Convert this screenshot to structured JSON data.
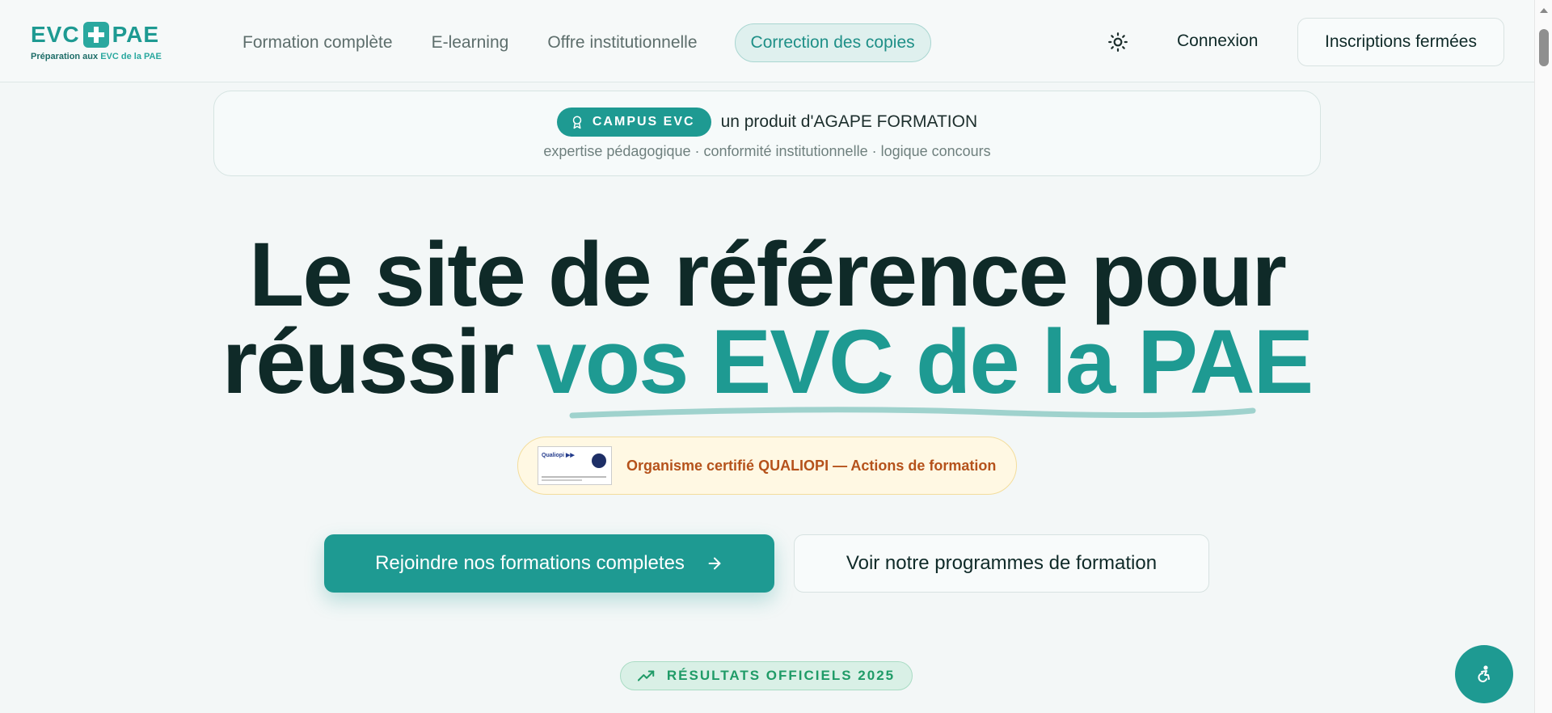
{
  "header": {
    "logo": {
      "brand_left": "EVC",
      "brand_right": "PAE",
      "tagline_prefix": "Préparation aux",
      "tagline_highlight": "EVC de la",
      "tagline_suffix": "PAE"
    },
    "nav": [
      {
        "label": "Formation complète"
      },
      {
        "label": "E-learning"
      },
      {
        "label": "Offre institutionnelle"
      },
      {
        "label": "Correction des copies",
        "active": true
      }
    ],
    "theme_toggle_icon": "sun-icon",
    "login_label": "Connexion",
    "signup_label": "Inscriptions fermées"
  },
  "banner": {
    "badge_label": "CAMPUS EVC",
    "badge_icon": "award-icon",
    "text": "un produit d'AGAPE FORMATION",
    "subtext": "expertise pédagogique · conformité institutionnelle · logique concours"
  },
  "hero": {
    "title_line1": "Le site de référence pour",
    "title_line2_plain": "réussir ",
    "title_line2_accent": "vos EVC de la PAE",
    "certification_text": "Organisme certifié QUALIOPI — Actions de formation",
    "cta_primary": "Rejoindre nos formations completes",
    "cta_secondary": "Voir notre programmes de formation"
  },
  "results_badge": {
    "label": "RÉSULTATS OFFICIELS 2025",
    "icon": "trending-up-icon"
  },
  "accessibility_button_icon": "accessibility-icon",
  "colors": {
    "accent": "#1e9a92",
    "text_dark": "#0f2a28",
    "qualiopi_text": "#b5521b",
    "results_green": "#1f9b67"
  }
}
